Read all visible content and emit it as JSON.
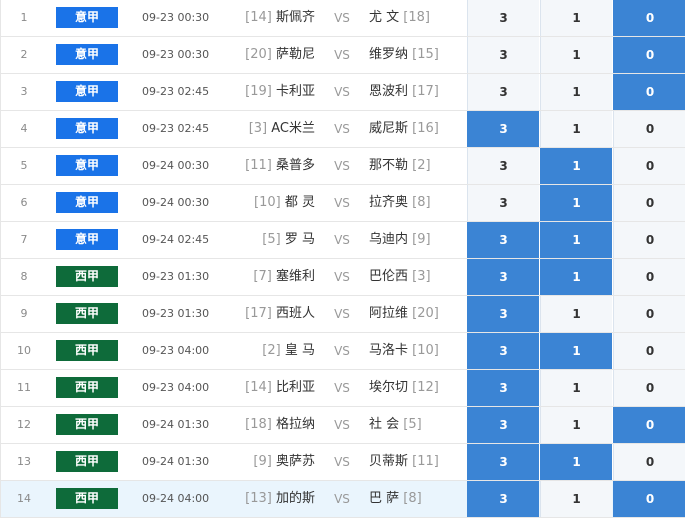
{
  "colors": {
    "serie_a": "#1a73e8",
    "la_liga": "#0e6b3a",
    "selected": "#3b84d4",
    "unselected": "#f4f7fa"
  },
  "matches": [
    {
      "index": "1",
      "league": "意甲",
      "time": "09-23 00:30",
      "home_rank": "[14]",
      "home": "斯佩齐",
      "vs": "VS",
      "away": "尤 文",
      "away_rank": "[18]",
      "options": [
        "3",
        "1",
        "0"
      ],
      "selected": [
        false,
        false,
        true
      ]
    },
    {
      "index": "2",
      "league": "意甲",
      "time": "09-23 00:30",
      "home_rank": "[20]",
      "home": "萨勒尼",
      "vs": "VS",
      "away": "维罗纳",
      "away_rank": "[15]",
      "options": [
        "3",
        "1",
        "0"
      ],
      "selected": [
        false,
        false,
        true
      ]
    },
    {
      "index": "3",
      "league": "意甲",
      "time": "09-23 02:45",
      "home_rank": "[19]",
      "home": "卡利亚",
      "vs": "VS",
      "away": "恩波利",
      "away_rank": "[17]",
      "options": [
        "3",
        "1",
        "0"
      ],
      "selected": [
        false,
        false,
        true
      ]
    },
    {
      "index": "4",
      "league": "意甲",
      "time": "09-23 02:45",
      "home_rank": "[3]",
      "home": "AC米兰",
      "vs": "VS",
      "away": "威尼斯",
      "away_rank": "[16]",
      "options": [
        "3",
        "1",
        "0"
      ],
      "selected": [
        true,
        false,
        false
      ]
    },
    {
      "index": "5",
      "league": "意甲",
      "time": "09-24 00:30",
      "home_rank": "[11]",
      "home": "桑普多",
      "vs": "VS",
      "away": "那不勒",
      "away_rank": "[2]",
      "options": [
        "3",
        "1",
        "0"
      ],
      "selected": [
        false,
        true,
        false
      ]
    },
    {
      "index": "6",
      "league": "意甲",
      "time": "09-24 00:30",
      "home_rank": "[10]",
      "home": "都 灵",
      "vs": "VS",
      "away": "拉齐奥",
      "away_rank": "[8]",
      "options": [
        "3",
        "1",
        "0"
      ],
      "selected": [
        false,
        true,
        false
      ]
    },
    {
      "index": "7",
      "league": "意甲",
      "time": "09-24 02:45",
      "home_rank": "[5]",
      "home": "罗 马",
      "vs": "VS",
      "away": "乌迪内",
      "away_rank": "[9]",
      "options": [
        "3",
        "1",
        "0"
      ],
      "selected": [
        true,
        true,
        false
      ]
    },
    {
      "index": "8",
      "league": "西甲",
      "time": "09-23 01:30",
      "home_rank": "[7]",
      "home": "塞维利",
      "vs": "VS",
      "away": "巴伦西",
      "away_rank": "[3]",
      "options": [
        "3",
        "1",
        "0"
      ],
      "selected": [
        true,
        true,
        false
      ]
    },
    {
      "index": "9",
      "league": "西甲",
      "time": "09-23 01:30",
      "home_rank": "[17]",
      "home": "西班人",
      "vs": "VS",
      "away": "阿拉维",
      "away_rank": "[20]",
      "options": [
        "3",
        "1",
        "0"
      ],
      "selected": [
        true,
        false,
        false
      ]
    },
    {
      "index": "10",
      "league": "西甲",
      "time": "09-23 04:00",
      "home_rank": "[2]",
      "home": "皇 马",
      "vs": "VS",
      "away": "马洛卡",
      "away_rank": "[10]",
      "options": [
        "3",
        "1",
        "0"
      ],
      "selected": [
        true,
        true,
        false
      ]
    },
    {
      "index": "11",
      "league": "西甲",
      "time": "09-23 04:00",
      "home_rank": "[14]",
      "home": "比利亚",
      "vs": "VS",
      "away": "埃尔切",
      "away_rank": "[12]",
      "options": [
        "3",
        "1",
        "0"
      ],
      "selected": [
        true,
        false,
        false
      ]
    },
    {
      "index": "12",
      "league": "西甲",
      "time": "09-24 01:30",
      "home_rank": "[18]",
      "home": "格拉纳",
      "vs": "VS",
      "away": "社 会",
      "away_rank": "[5]",
      "options": [
        "3",
        "1",
        "0"
      ],
      "selected": [
        true,
        false,
        true
      ]
    },
    {
      "index": "13",
      "league": "西甲",
      "time": "09-24 01:30",
      "home_rank": "[9]",
      "home": "奥萨苏",
      "vs": "VS",
      "away": "贝蒂斯",
      "away_rank": "[11]",
      "options": [
        "3",
        "1",
        "0"
      ],
      "selected": [
        true,
        true,
        false
      ]
    },
    {
      "index": "14",
      "league": "西甲",
      "time": "09-24 04:00",
      "home_rank": "[13]",
      "home": "加的斯",
      "vs": "VS",
      "away": "巴 萨",
      "away_rank": "[8]",
      "options": [
        "3",
        "1",
        "0"
      ],
      "selected": [
        true,
        false,
        true
      ],
      "highlighted": true
    }
  ]
}
